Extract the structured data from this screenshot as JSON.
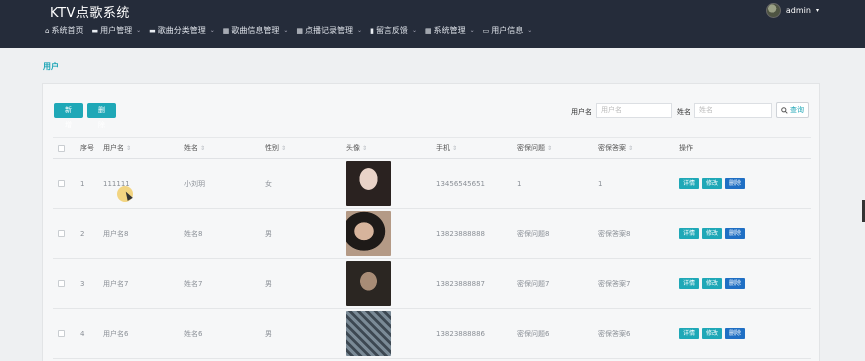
{
  "app": {
    "title": "KTV点歌系统"
  },
  "user": {
    "name": "admin",
    "caret": "▾",
    "avatar_icon": "user-avatar"
  },
  "nav": [
    {
      "label": "系统首页",
      "icon": "⌂",
      "has_dropdown": false
    },
    {
      "label": "用户管理",
      "icon": "▬",
      "has_dropdown": true
    },
    {
      "label": "歌曲分类管理",
      "icon": "▬",
      "has_dropdown": true
    },
    {
      "label": "歌曲信息管理",
      "icon": "▦",
      "has_dropdown": true
    },
    {
      "label": "点播记录管理",
      "icon": "▦",
      "has_dropdown": true
    },
    {
      "label": "留言反馈",
      "icon": "▮",
      "has_dropdown": true
    },
    {
      "label": "系统管理",
      "icon": "▦",
      "has_dropdown": true
    },
    {
      "label": "用户信息",
      "icon": "▭",
      "has_dropdown": true
    }
  ],
  "nav_arrow": "⌄",
  "breadcrumb": "用户",
  "toolbar": {
    "add_label": "新增",
    "delete_label": "删除"
  },
  "filters": {
    "username_label": "用户名",
    "username_placeholder": "用户名",
    "name_label": "姓名",
    "name_placeholder": "姓名",
    "search_label": "查询",
    "search_icon": "search-icon"
  },
  "table": {
    "headers": {
      "index": "序号",
      "username": "用户名",
      "name": "姓名",
      "gender": "性别",
      "avatar": "头像",
      "phone": "手机",
      "question": "密保问题",
      "answer": "密保答案",
      "ops": "操作"
    },
    "sort_glyph": "⇕",
    "op_labels": {
      "detail": "详情",
      "edit": "修改",
      "remove": "删除"
    },
    "rows": [
      {
        "index": "1",
        "username": "111111",
        "name": "小刘玥",
        "gender": "女",
        "phone": "13456545651",
        "question": "1",
        "answer": "1"
      },
      {
        "index": "2",
        "username": "用户名8",
        "name": "姓名8",
        "gender": "男",
        "phone": "13823888888",
        "question": "密保问题8",
        "answer": "密保答案8"
      },
      {
        "index": "3",
        "username": "用户名7",
        "name": "姓名7",
        "gender": "男",
        "phone": "13823888887",
        "question": "密保问题7",
        "answer": "密保答案7"
      },
      {
        "index": "4",
        "username": "用户名6",
        "name": "姓名6",
        "gender": "男",
        "phone": "13823888886",
        "question": "密保问题6",
        "answer": "密保答案6"
      }
    ]
  },
  "colors": {
    "topbar": "#252c3a",
    "accent": "#1fa8b7",
    "remove": "#1f6fc4",
    "page_bg": "#eef0f2"
  }
}
